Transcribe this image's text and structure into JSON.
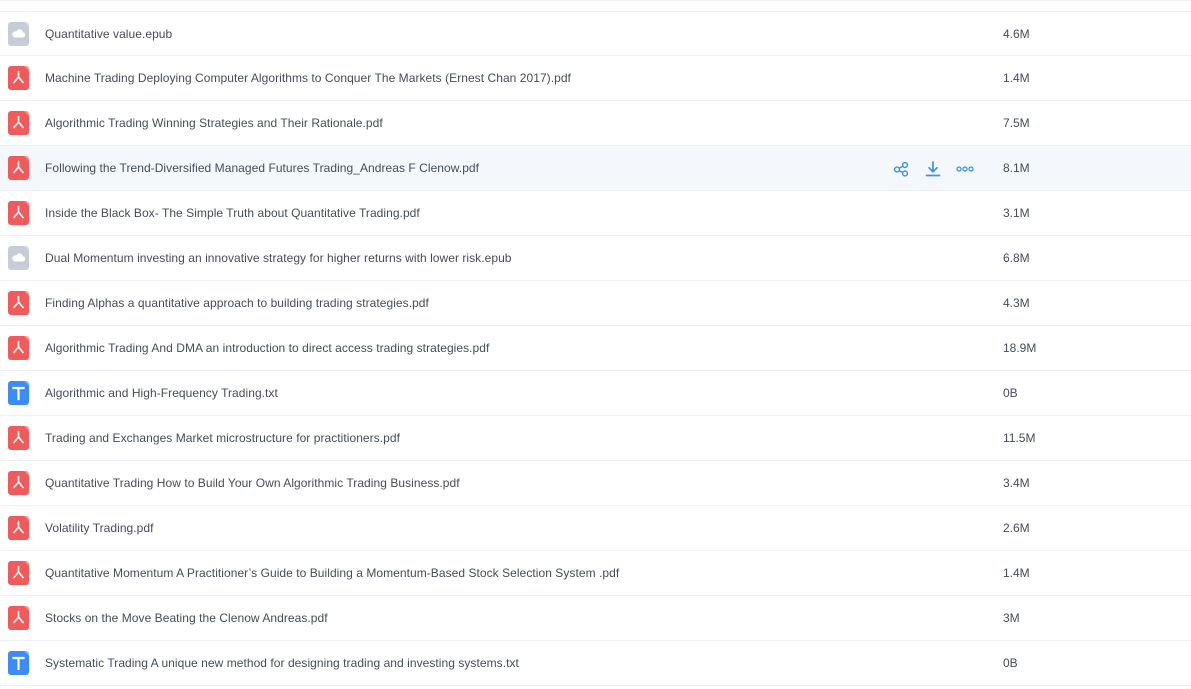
{
  "colors": {
    "pdf": "#f15a5a",
    "epub": "#c5cdd8",
    "txt": "#3c8cf8",
    "action": "#3b8ff0",
    "hover_bg": "#f4f8fd"
  },
  "row_actions": {
    "share_icon": "share-icon",
    "download_icon": "download-icon",
    "more_icon": "more-icon"
  },
  "files": [
    {
      "name": "Quantitative value.epub",
      "size": "4.6M",
      "type": "epub",
      "icon": "cloud-file-icon"
    },
    {
      "name": "Machine Trading Deploying Computer Algorithms to Conquer The Markets (Ernest Chan 2017).pdf",
      "size": "1.4M",
      "type": "pdf",
      "icon": "pdf-file-icon"
    },
    {
      "name": "Algorithmic Trading Winning Strategies and Their Rationale.pdf",
      "size": "7.5M",
      "type": "pdf",
      "icon": "pdf-file-icon"
    },
    {
      "name": "Following the Trend-Diversified Managed Futures Trading_Andreas F Clenow.pdf",
      "size": "8.1M",
      "type": "pdf",
      "icon": "pdf-file-icon",
      "hovered": true
    },
    {
      "name": "Inside the Black Box- The Simple Truth about Quantitative Trading.pdf",
      "size": "3.1M",
      "type": "pdf",
      "icon": "pdf-file-icon"
    },
    {
      "name": "Dual Momentum investing an innovative strategy for higher returns with lower risk.epub",
      "size": "6.8M",
      "type": "epub",
      "icon": "cloud-file-icon"
    },
    {
      "name": "Finding Alphas a quantitative approach to building trading strategies.pdf",
      "size": "4.3M",
      "type": "pdf",
      "icon": "pdf-file-icon"
    },
    {
      "name": "Algorithmic Trading And DMA an introduction to direct access trading strategies.pdf",
      "size": "18.9M",
      "type": "pdf",
      "icon": "pdf-file-icon"
    },
    {
      "name": "Algorithmic and High-Frequency Trading.txt",
      "size": "0B",
      "type": "txt",
      "icon": "text-file-icon"
    },
    {
      "name": "Trading and Exchanges Market microstructure for practitioners.pdf",
      "size": "11.5M",
      "type": "pdf",
      "icon": "pdf-file-icon"
    },
    {
      "name": "Quantitative Trading How to Build Your Own Algorithmic Trading Business.pdf",
      "size": "3.4M",
      "type": "pdf",
      "icon": "pdf-file-icon"
    },
    {
      "name": "Volatility Trading.pdf",
      "size": "2.6M",
      "type": "pdf",
      "icon": "pdf-file-icon"
    },
    {
      "name": "Quantitative Momentum A Practitioner’s Guide to Building a Momentum-Based Stock Selection System .pdf",
      "size": "1.4M",
      "type": "pdf",
      "icon": "pdf-file-icon"
    },
    {
      "name": "Stocks on the Move Beating the Clenow Andreas.pdf",
      "size": "3M",
      "type": "pdf",
      "icon": "pdf-file-icon"
    },
    {
      "name": "Systematic Trading A unique new method for designing trading and investing systems.txt",
      "size": "0B",
      "type": "txt",
      "icon": "text-file-icon"
    }
  ]
}
